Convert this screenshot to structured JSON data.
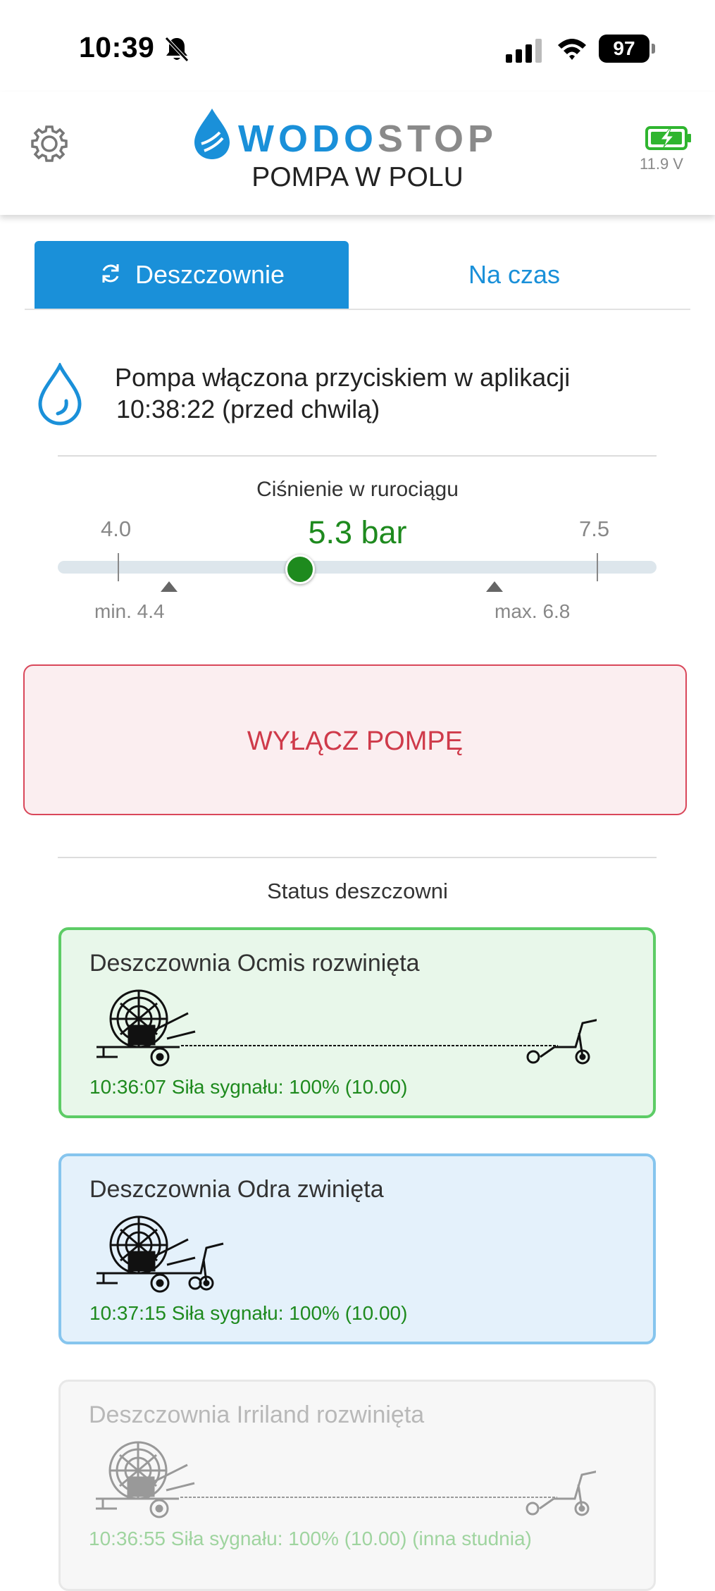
{
  "status_bar": {
    "time": "10:39",
    "battery_percent": "97",
    "icons": [
      "bell-slash-icon",
      "cellular-signal-icon",
      "wifi-icon",
      "battery-icon"
    ]
  },
  "header": {
    "logo_part1": "WODO",
    "logo_part2": "STOP",
    "subtitle": "POMPA W POLU",
    "battery_voltage": "11.9 V",
    "colors": {
      "brand_blue": "#1a90d9",
      "brand_gray": "#8a8a8a",
      "battery_green": "#2fb52f"
    }
  },
  "tabs": [
    {
      "label": "Deszczownie",
      "icon": "refresh-icon",
      "active": true
    },
    {
      "label": "Na czas",
      "active": false
    }
  ],
  "pump_status": {
    "message": "Pompa włączona przyciskiem w aplikacji",
    "time_info": "10:38:22 (przed chwilą)",
    "icon": "water-drop-icon"
  },
  "pressure": {
    "title": "Ciśnienie w rurociągu",
    "scale_min": "4.0",
    "scale_max": "7.5",
    "current_value": 5.3,
    "current_display": "5.3 bar",
    "min_label": "min. 4.4",
    "max_label": "max. 6.8",
    "min_threshold": 4.4,
    "max_threshold": 6.8
  },
  "stop_button": {
    "label": "WYŁĄCZ POMPĘ",
    "color": "#cf3a4a"
  },
  "sprinklers": {
    "section_title": "Status deszczowni",
    "items": [
      {
        "title": "Deszczownia Ocmis rozwinięta",
        "footer": "10:36:07 Siła sygnału: 100% (10.00)",
        "state": "unrolled"
      },
      {
        "title": "Deszczownia Odra zwinięta",
        "footer": "10:37:15 Siła sygnału: 100% (10.00)",
        "state": "rolled"
      },
      {
        "title": "Deszczownia Irriland rozwinięta",
        "footer": "10:36:55 Siła sygnału: 100% (10.00) (inna studnia)",
        "state": "unrolled-inactive"
      }
    ]
  }
}
